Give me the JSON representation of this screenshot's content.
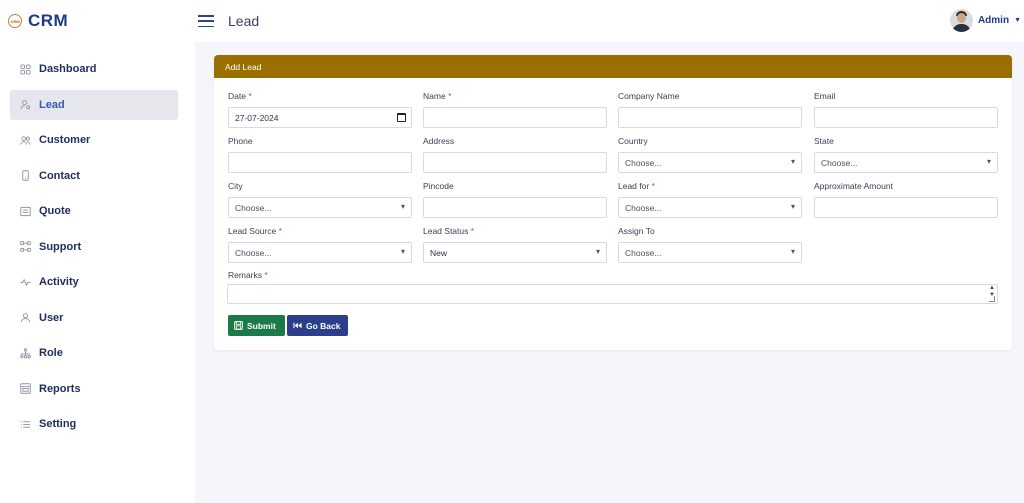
{
  "brand": {
    "logo_text": "CRM",
    "name": "CRM"
  },
  "sidebar": {
    "items": [
      {
        "label": "Dashboard",
        "icon": "grid-icon",
        "active": false
      },
      {
        "label": "Lead",
        "icon": "user-gear-icon",
        "active": true
      },
      {
        "label": "Customer",
        "icon": "users-icon",
        "active": false
      },
      {
        "label": "Contact",
        "icon": "phone-icon",
        "active": false
      },
      {
        "label": "Quote",
        "icon": "document-icon",
        "active": false
      },
      {
        "label": "Support",
        "icon": "support-icon",
        "active": false
      },
      {
        "label": "Activity",
        "icon": "pulse-icon",
        "active": false
      },
      {
        "label": "User",
        "icon": "user-icon",
        "active": false
      },
      {
        "label": "Role",
        "icon": "hierarchy-icon",
        "active": false
      },
      {
        "label": "Reports",
        "icon": "report-icon",
        "active": false
      },
      {
        "label": "Setting",
        "icon": "list-icon",
        "active": false
      }
    ]
  },
  "header": {
    "title": "Lead",
    "user_name": "Admin"
  },
  "form": {
    "title": "Add Lead",
    "fields": {
      "date": {
        "label": "Date",
        "value": "27-07-2024"
      },
      "name": {
        "label": "Name",
        "value": ""
      },
      "company": {
        "label": "Company Name",
        "value": ""
      },
      "email": {
        "label": "Email",
        "value": ""
      },
      "phone": {
        "label": "Phone",
        "value": ""
      },
      "address": {
        "label": "Address",
        "value": ""
      },
      "country": {
        "label": "Country",
        "value": "Choose..."
      },
      "state": {
        "label": "State",
        "value": "Choose..."
      },
      "city": {
        "label": "City",
        "value": "Choose..."
      },
      "pincode": {
        "label": "Pincode",
        "value": ""
      },
      "lead_for": {
        "label": "Lead for",
        "value": "Choose..."
      },
      "amount": {
        "label": "Approximate Amount",
        "value": ""
      },
      "lead_source": {
        "label": "Lead Source",
        "value": "Choose..."
      },
      "lead_status": {
        "label": "Lead Status",
        "value": "New"
      },
      "assign_to": {
        "label": "Assign To",
        "value": "Choose..."
      },
      "remarks": {
        "label": "Remarks",
        "value": ""
      }
    },
    "required_mark": "*",
    "submit_label": "Submit",
    "back_label": "Go Back"
  },
  "colors": {
    "header_bar": "#9a6e00",
    "submit": "#1b7a47",
    "back": "#2b3e8c",
    "brand": "#1f3a8a"
  }
}
